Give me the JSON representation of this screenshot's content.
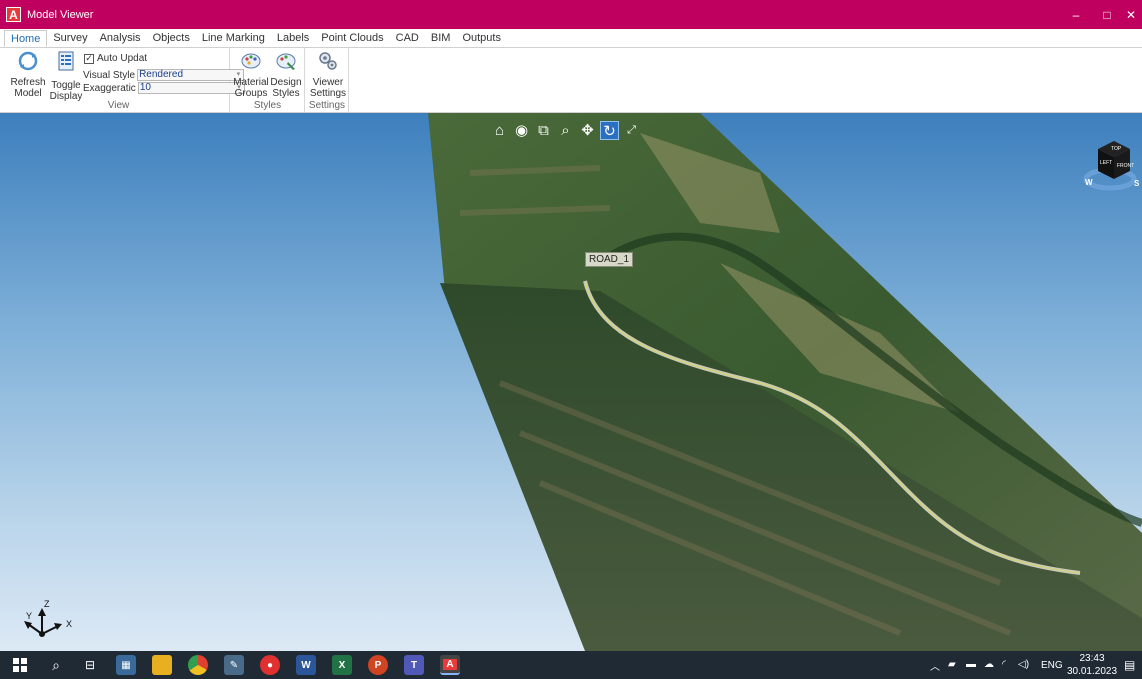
{
  "window": {
    "title": "Model Viewer",
    "minimize": "–",
    "maximize": "□",
    "close": "✕"
  },
  "tabs": [
    "Home",
    "Survey",
    "Analysis",
    "Objects",
    "Line Marking",
    "Labels",
    "Point Clouds",
    "CAD",
    "BIM",
    "Outputs"
  ],
  "ribbon": {
    "refresh_label_1": "Refresh",
    "refresh_label_2": "Model",
    "toggle_label_1": "Toggle",
    "toggle_label_2": "Display",
    "auto_update_label": "Auto Updat",
    "auto_update_checked": true,
    "visual_style_label": "Visual Style",
    "visual_style_value": "Rendered",
    "exaggeration_label": "Exaggeratic",
    "exaggeration_value": "10",
    "view_group": "View",
    "material_label_1": "Material",
    "material_label_2": "Groups",
    "design_label_1": "Design",
    "design_label_2": "Styles",
    "styles_group": "Styles",
    "viewer_label_1": "Viewer",
    "viewer_label_2": "Settings",
    "settings_group": "Settings"
  },
  "viewport": {
    "road_label": "ROAD_1",
    "axis_z": "Z",
    "axis_y": "Y",
    "axis_x": "X",
    "viewcube_top": "TOP",
    "viewcube_front": "FRONT",
    "viewcube_left": "LEFT",
    "compass_w": "W",
    "compass_s": "S"
  },
  "nav_tools": [
    "home-icon",
    "orbit-wheel-icon",
    "zoom-window-icon",
    "zoom-icon",
    "pan-icon",
    "orbit-icon",
    "fullscreen-icon"
  ],
  "taskbar": {
    "language": "ENG",
    "time": "23:43",
    "date": "30.01.2023"
  },
  "colors": {
    "titlebar": "#c0005e",
    "accent_tab": "#1e6fb8",
    "taskbar": "#1f2a35"
  }
}
